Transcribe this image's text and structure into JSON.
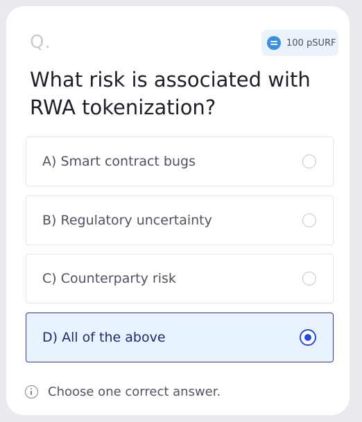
{
  "question_marker": "Q.",
  "reward": {
    "amount": "100 pSURF",
    "icon": "coin-icon"
  },
  "question": "What risk is associated with RWA tokenization?",
  "options": [
    {
      "label": "A) Smart contract bugs",
      "selected": false
    },
    {
      "label": "B) Regulatory uncertainty",
      "selected": false
    },
    {
      "label": "C) Counterparty risk",
      "selected": false
    },
    {
      "label": "D) All of the above",
      "selected": true
    }
  ],
  "hint": {
    "text": "Choose one correct answer.",
    "icon": "info-icon"
  },
  "colors": {
    "accent": "#2448e0",
    "selected_border": "#2b3a8e",
    "selected_bg": "#e9f3ff",
    "reward_bg": "#eaf3fb",
    "coin": "#3a8ee6"
  }
}
